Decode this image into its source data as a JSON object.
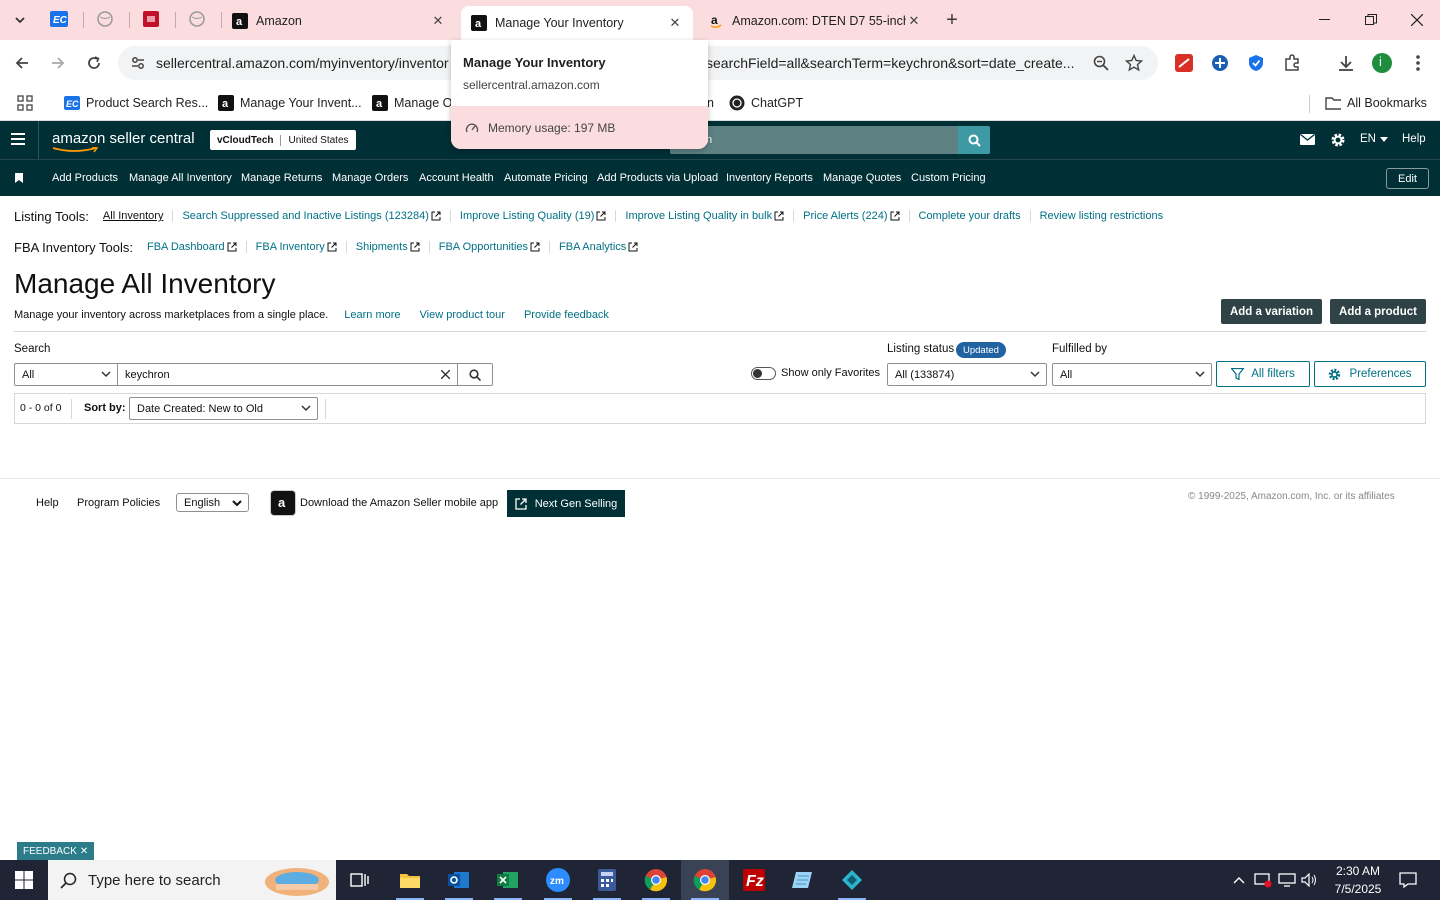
{
  "browser": {
    "tabs": [
      {
        "title": "Amazon"
      },
      {
        "title": "Manage Your Inventory"
      },
      {
        "title": "Amazon.com: DTEN D7 55-inch"
      }
    ],
    "address_left": "sellercentral.amazon.com/myinventory/inventor",
    "address_right": "searchField=all&searchTerm=keychron&sort=date_create...",
    "bookmarks": [
      "Product Search Res...",
      "Manage Your Invent...",
      "Manage O",
      "n",
      "ChatGPT"
    ],
    "all_bookmarks": "All Bookmarks",
    "profile_letter": "i",
    "hover_card": {
      "title": "Manage Your Inventory",
      "url": "sellercentral.amazon.com",
      "memory": "Memory usage: 197 MB"
    }
  },
  "header": {
    "logo": "amazon seller central",
    "account": "vCloudTech",
    "marketplace": "United States",
    "search_partial": "n",
    "language": "EN",
    "help": "Help"
  },
  "nav": {
    "items": [
      "Add Products",
      "Manage All Inventory",
      "Manage Returns",
      "Manage Orders",
      "Account Health",
      "Automate Pricing",
      "Add Products via Upload",
      "Inventory Reports",
      "Manage Quotes",
      "Custom Pricing"
    ],
    "edit": "Edit"
  },
  "listing_tools": {
    "label": "Listing Tools:",
    "links": [
      "All Inventory",
      "Search Suppressed and Inactive Listings (123284)",
      "Improve Listing Quality (19)",
      "Improve Listing Quality in bulk",
      "Price Alerts (224)",
      "Complete your drafts",
      "Review listing restrictions"
    ]
  },
  "fba_tools": {
    "label": "FBA Inventory Tools:",
    "links": [
      "FBA Dashboard",
      "FBA Inventory",
      "Shipments",
      "FBA Opportunities",
      "FBA Analytics"
    ]
  },
  "page": {
    "title": "Manage All Inventory",
    "subtitle": "Manage your inventory across marketplaces from a single place.",
    "learn_more": "Learn more",
    "product_tour": "View product tour",
    "feedback": "Provide feedback",
    "add_variation": "Add a variation",
    "add_product": "Add a product"
  },
  "filters": {
    "search_label": "Search",
    "search_scope": "All",
    "search_value": "keychron",
    "favorites_label": "Show only Favorites",
    "listing_status_label": "Listing status",
    "listing_status_badge": "Updated",
    "listing_status_value": "All (133874)",
    "fulfilled_by_label": "Fulfilled by",
    "fulfilled_by_value": "All",
    "all_filters": "All filters",
    "preferences": "Preferences"
  },
  "results": {
    "count": "0 - 0 of 0",
    "sort_label": "Sort by:",
    "sort_value": "Date Created: New to Old"
  },
  "footer": {
    "help": "Help",
    "policies": "Program Policies",
    "language": "English",
    "mobile_app": "Download the Amazon Seller mobile app",
    "next_gen": "Next Gen Selling",
    "copyright": "© 1999-2025, Amazon.com, Inc. or its affiliates"
  },
  "feedback_tab": "FEEDBACK",
  "taskbar": {
    "search_placeholder": "Type here to search",
    "time": "2:30 AM",
    "date": "7/5/2025"
  },
  "colors": {
    "header_bg": "#002f36",
    "link": "#007185",
    "tab_strip": "#fbdde0"
  }
}
